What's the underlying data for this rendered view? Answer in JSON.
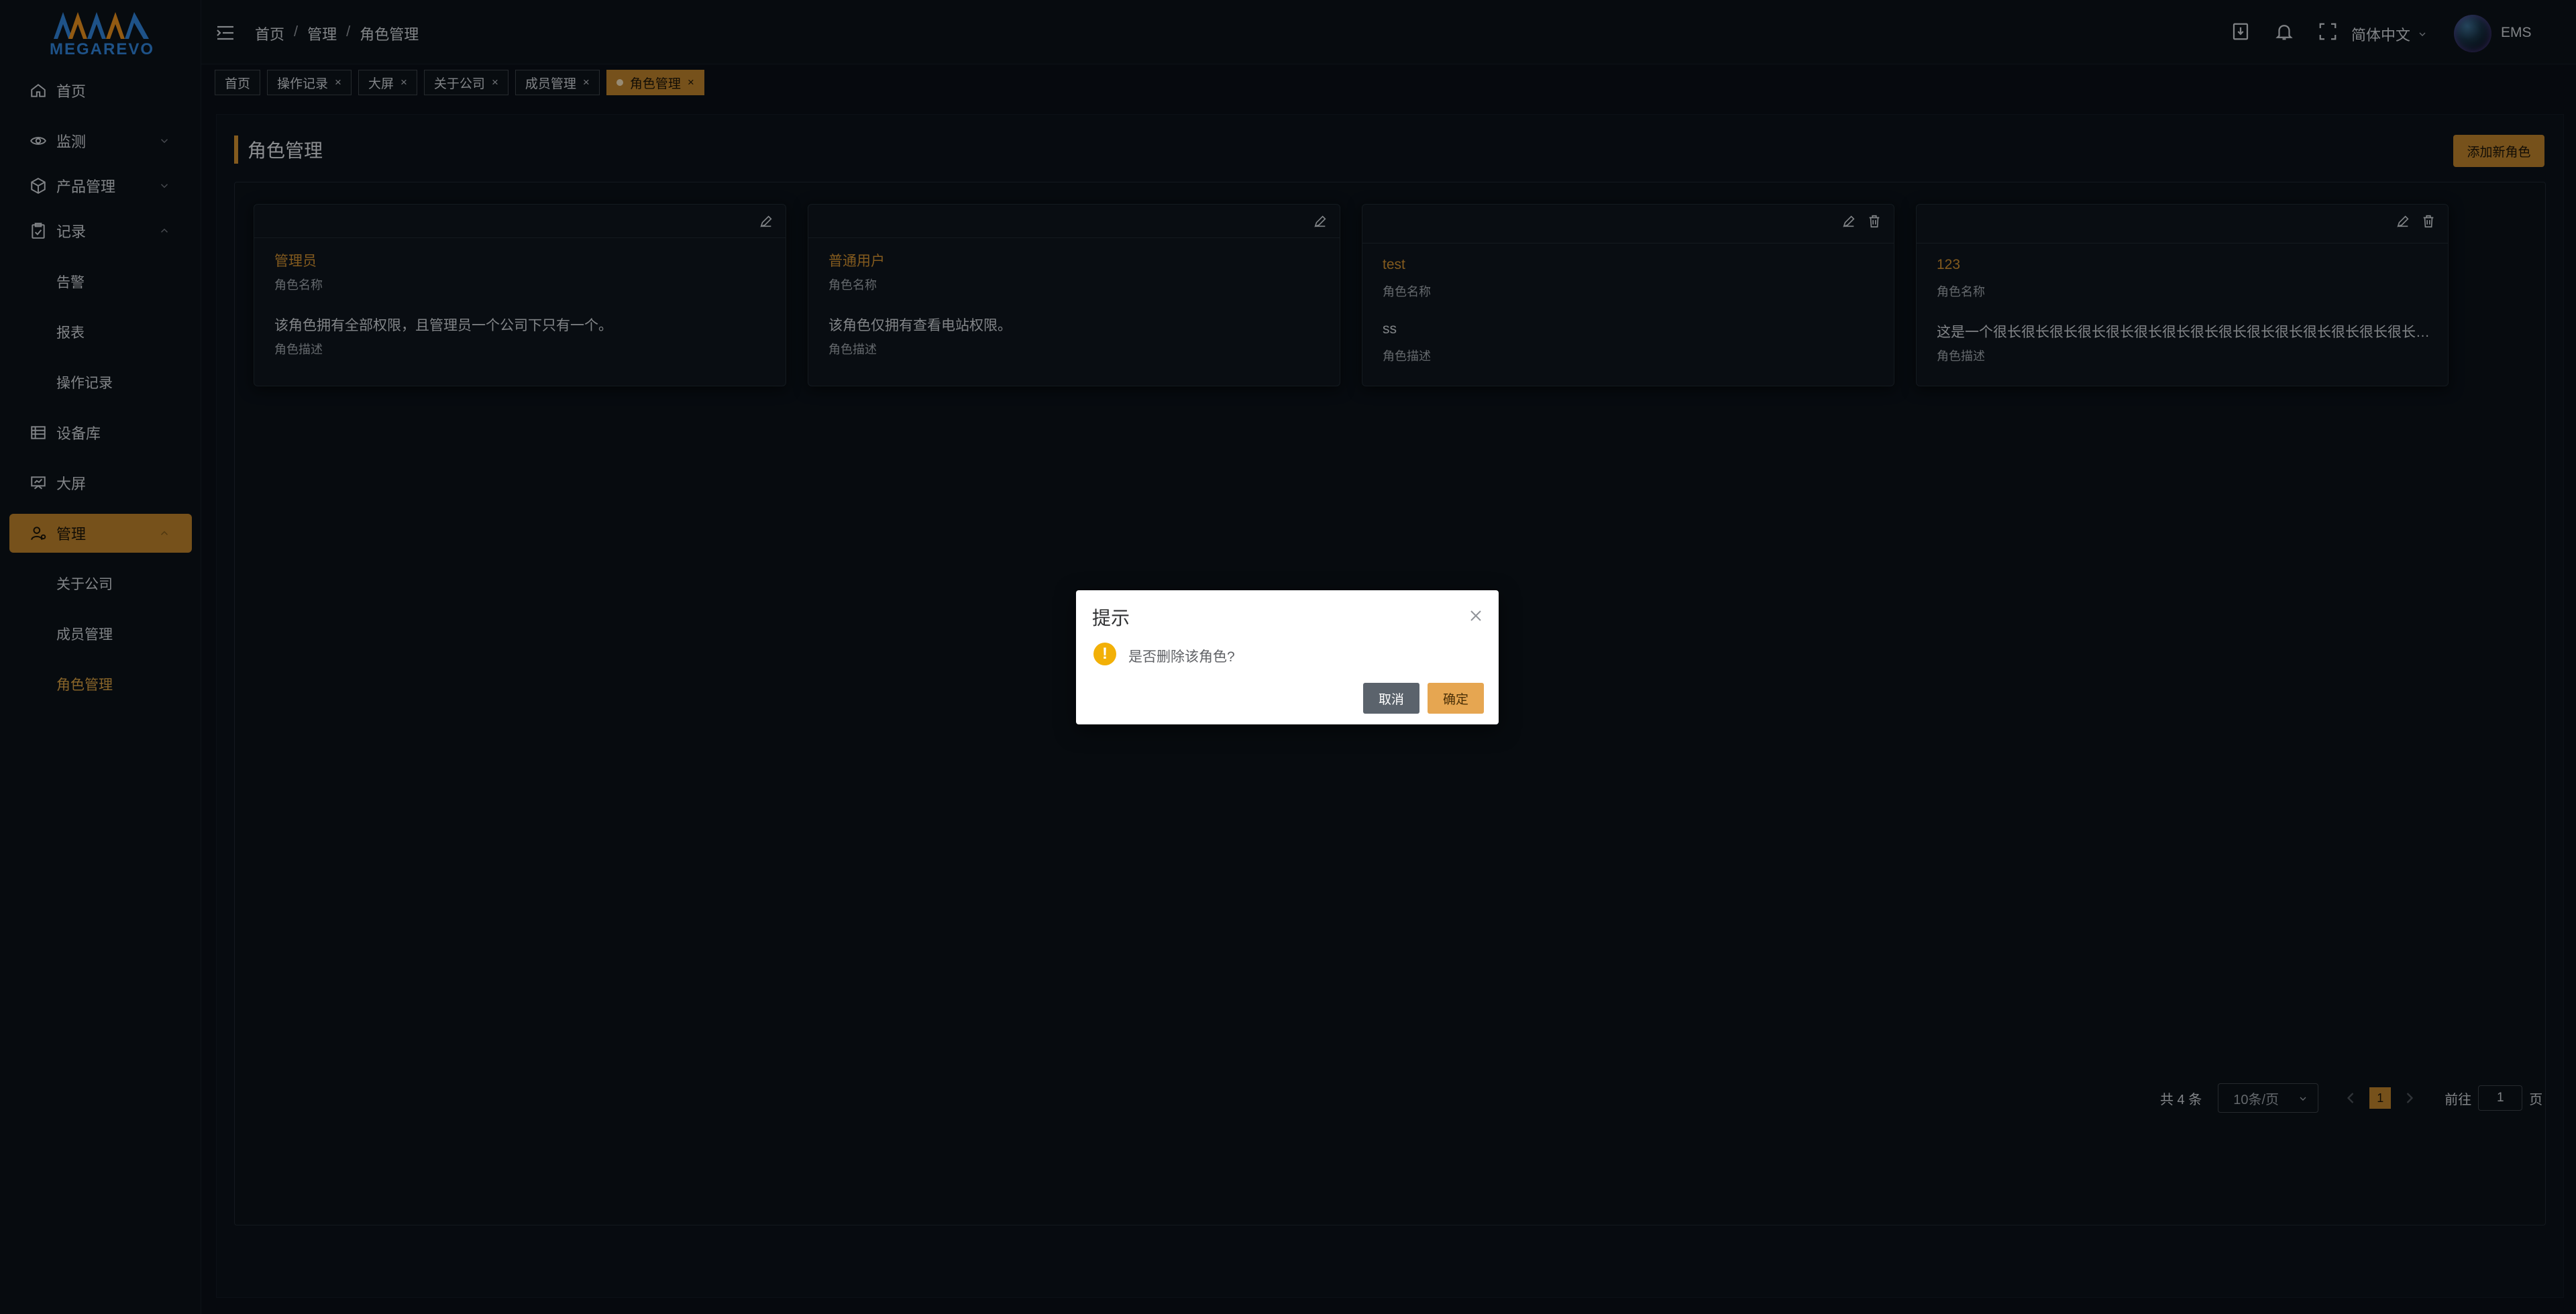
{
  "brand": {
    "logo_text": "MEGAREVO",
    "colors": {
      "accent": "#b57d2a",
      "logo_blue": "#2e7fd1",
      "logo_orange": "#e08a1d"
    }
  },
  "sidebar": {
    "items": [
      {
        "label": "首页",
        "icon": "home-icon"
      },
      {
        "label": "监测",
        "icon": "eye-icon"
      },
      {
        "label": "产品管理",
        "icon": "cube-icon"
      },
      {
        "label": "记录",
        "icon": "clipboard-icon"
      },
      {
        "label": "设备库",
        "icon": "list-icon"
      },
      {
        "label": "大屏",
        "icon": "monitor-icon"
      },
      {
        "label": "管理",
        "icon": "user-settings-icon"
      }
    ],
    "record_sub": [
      "告警",
      "报表",
      "操作记录"
    ],
    "manage_sub": [
      "关于公司",
      "成员管理",
      "角色管理"
    ]
  },
  "header": {
    "breadcrumb": [
      "首页",
      "管理",
      "角色管理"
    ],
    "breadcrumb_sep": "/",
    "language": "简体中文",
    "username": "EMS"
  },
  "tabs": {
    "home": "首页",
    "items": [
      "操作记录",
      "大屏",
      "关于公司",
      "成员管理"
    ],
    "active": "角色管理",
    "close_glyph": "×"
  },
  "page": {
    "title": "角色管理",
    "add_button": "添加新角色"
  },
  "roles": [
    {
      "name": "管理员",
      "name_label": "角色名称",
      "description": "该角色拥有全部权限，且管理员一个公司下只有一个。",
      "desc_label": "角色描述"
    },
    {
      "name": "普通用户",
      "name_label": "角色名称",
      "description": "该角色仅拥有查看电站权限。",
      "desc_label": "角色描述"
    },
    {
      "name": "test",
      "name_label": "角色名称",
      "description": "ss",
      "desc_label": "角色描述"
    },
    {
      "name": "123",
      "name_label": "角色名称",
      "description": "这是一个很长很长很长很长很长很长很长很长很长很长很长很长很长很长很长很长很长很长很长很长很长很长很长很长很长很长很长很长",
      "desc_label": "角色描述"
    }
  ],
  "pagination": {
    "total": "共 4 条",
    "page_size": "10条/页",
    "current_page": "1",
    "goto_prefix": "前往",
    "goto_value": "1",
    "goto_suffix": "页"
  },
  "dialog": {
    "title": "提示",
    "message": "是否删除该角色?",
    "cancel": "取消",
    "confirm": "确定",
    "warn_glyph": "!"
  }
}
